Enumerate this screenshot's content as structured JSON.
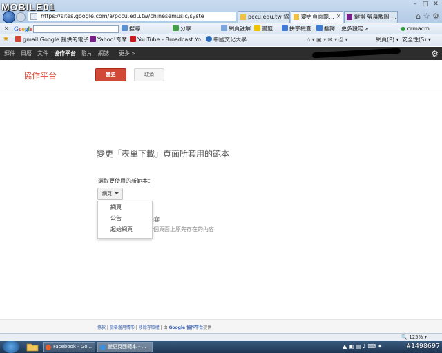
{
  "browser": {
    "watermark_logo": "MOBILE01",
    "address": "https://sites.google.com/a/pccu.edu.tw/chinesemusic/syste",
    "tabs": [
      {
        "label": "pccu.edu.tw 協..."
      },
      {
        "label": "變更頁面範..."
      },
      {
        "label": "鍵盤 螢幕截圖 - ..."
      }
    ],
    "toolbar1": {
      "search_placeholder": "",
      "bookmark_label": "搜尋",
      "share_label": "分享",
      "pagerank_label": "網頁註解",
      "bookmarks_label": "書籤",
      "spell_label": "拼字檢查",
      "translate_label": "翻譯",
      "more_settings_label": "更多設定",
      "user": "crmacm"
    },
    "favorites": [
      {
        "label": "gmail Google 提供的電子..."
      },
      {
        "label": "Yahoo!奇摩"
      },
      {
        "label": "YouTube - Broadcast Yo..."
      },
      {
        "label": "中國文化大學"
      }
    ],
    "toolbar2_right": {
      "page_label": "網頁(P)",
      "safety_label": "安全性(S)"
    }
  },
  "gbar": {
    "items": [
      "郵件",
      "日曆",
      "文件",
      "協作平台",
      "影片",
      "網誌",
      "更多 »"
    ],
    "selected_index": 3
  },
  "header": {
    "site_title": "協作平台",
    "change_label": "變更",
    "cancel_label": "取消"
  },
  "main": {
    "heading": "變更「表單下載」頁面所套用的範本",
    "select_label": "選取要使用的新範本：",
    "select_value": "網頁",
    "dropdown_options": [
      "網頁",
      "公告",
      "起始網頁"
    ],
    "bg_line1": "內容",
    "bg_line2": "這個頁面上原先存在的內容"
  },
  "footer": {
    "link1": "條款",
    "link2": "檢舉濫用情形",
    "link3": "移除存取權",
    "powered_prefix": "由 ",
    "powered_brand": "Google 協作平台",
    "powered_suffix": "提供"
  },
  "statusbar": {
    "zoom": "125%"
  },
  "taskbar": {
    "tasks": [
      {
        "label": "Facebook - Go..."
      },
      {
        "label": "變更頁面範本 - ..."
      }
    ],
    "watermark_id": "#1498697"
  },
  "colors": {
    "accent_red": "#d14836",
    "site_title": "#dd4b39",
    "gbar_bg": "#2d2d2d"
  }
}
